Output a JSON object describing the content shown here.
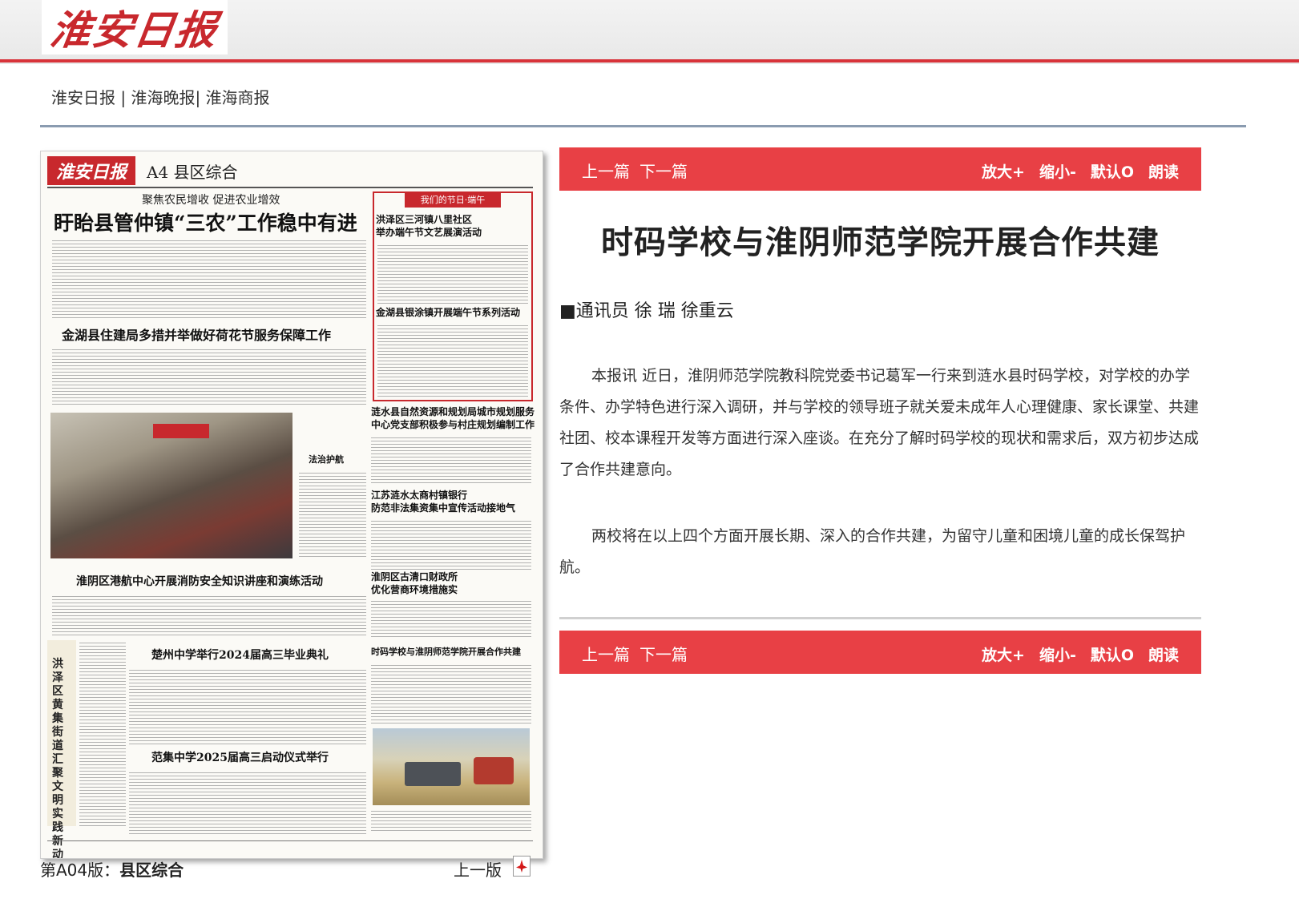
{
  "site": {
    "logo_text": "淮安日报"
  },
  "nav": {
    "links": [
      "淮安日报",
      "淮海晚报",
      "淮海商报"
    ],
    "sep1": " | ",
    "sep2": "| "
  },
  "paper": {
    "masthead": "淮安日报",
    "section": "A4 县区综合",
    "kicker": "聚焦农民增收 促进农业增效",
    "headline": "盱眙县管仲镇“三农”工作稳中有进",
    "box_tag": "我们的节日·端午",
    "headlines": [
      "洪泽区三河镇八里社区",
      "举办端午节文艺展演活动",
      "金湖县银涂镇开展端午节系列活动",
      "金湖县住建局多措并举做好荷花节服务保障工作",
      "涟水县自然资源和规划局城市规划服务",
      "中心党支部积极参与村庄规划编制工作",
      "法治护航",
      "江苏涟水太商村镇银行",
      "防范非法集资集中宣传活动接地气",
      "淮阴区港航中心开展消防安全知识讲座和演练活动",
      "淮阴区古清口财政所",
      "优化营商环境措施实",
      "楚州中学举行2024届高三毕业典礼",
      "时码学校与淮阴师范学院开展合作共建",
      "范集中学2025届高三启动仪式举行"
    ],
    "vertical_headline": "洪泽区黄集街道汇聚文明实践新动能"
  },
  "edition": {
    "label": "第A04版：",
    "name": "县区综合",
    "prev": "上一版"
  },
  "toolbar": {
    "prev": "上一篇",
    "next": "下一篇",
    "zoom_in": "放大+",
    "zoom_out": "缩小-",
    "default": "默认O",
    "read": "朗读"
  },
  "article": {
    "title": "时码学校与淮阴师范学院开展合作共建",
    "byline": "■通讯员 徐 瑞 徐重云",
    "paragraphs": [
      "本报讯 近日，淮阴师范学院教科院党委书记葛军一行来到涟水县时码学校，对学校的办学条件、办学特色进行深入调研，并与学校的领导班子就关爱未成年人心理健康、家长课堂、共建社团、校本课程开发等方面进行深入座谈。在充分了解时码学校的现状和需求后，双方初步达成了合作共建意向。",
      "两校将在以上四个方面开展长期、深入的合作共建，为留守儿童和困境儿童的成长保驾护航。"
    ]
  }
}
